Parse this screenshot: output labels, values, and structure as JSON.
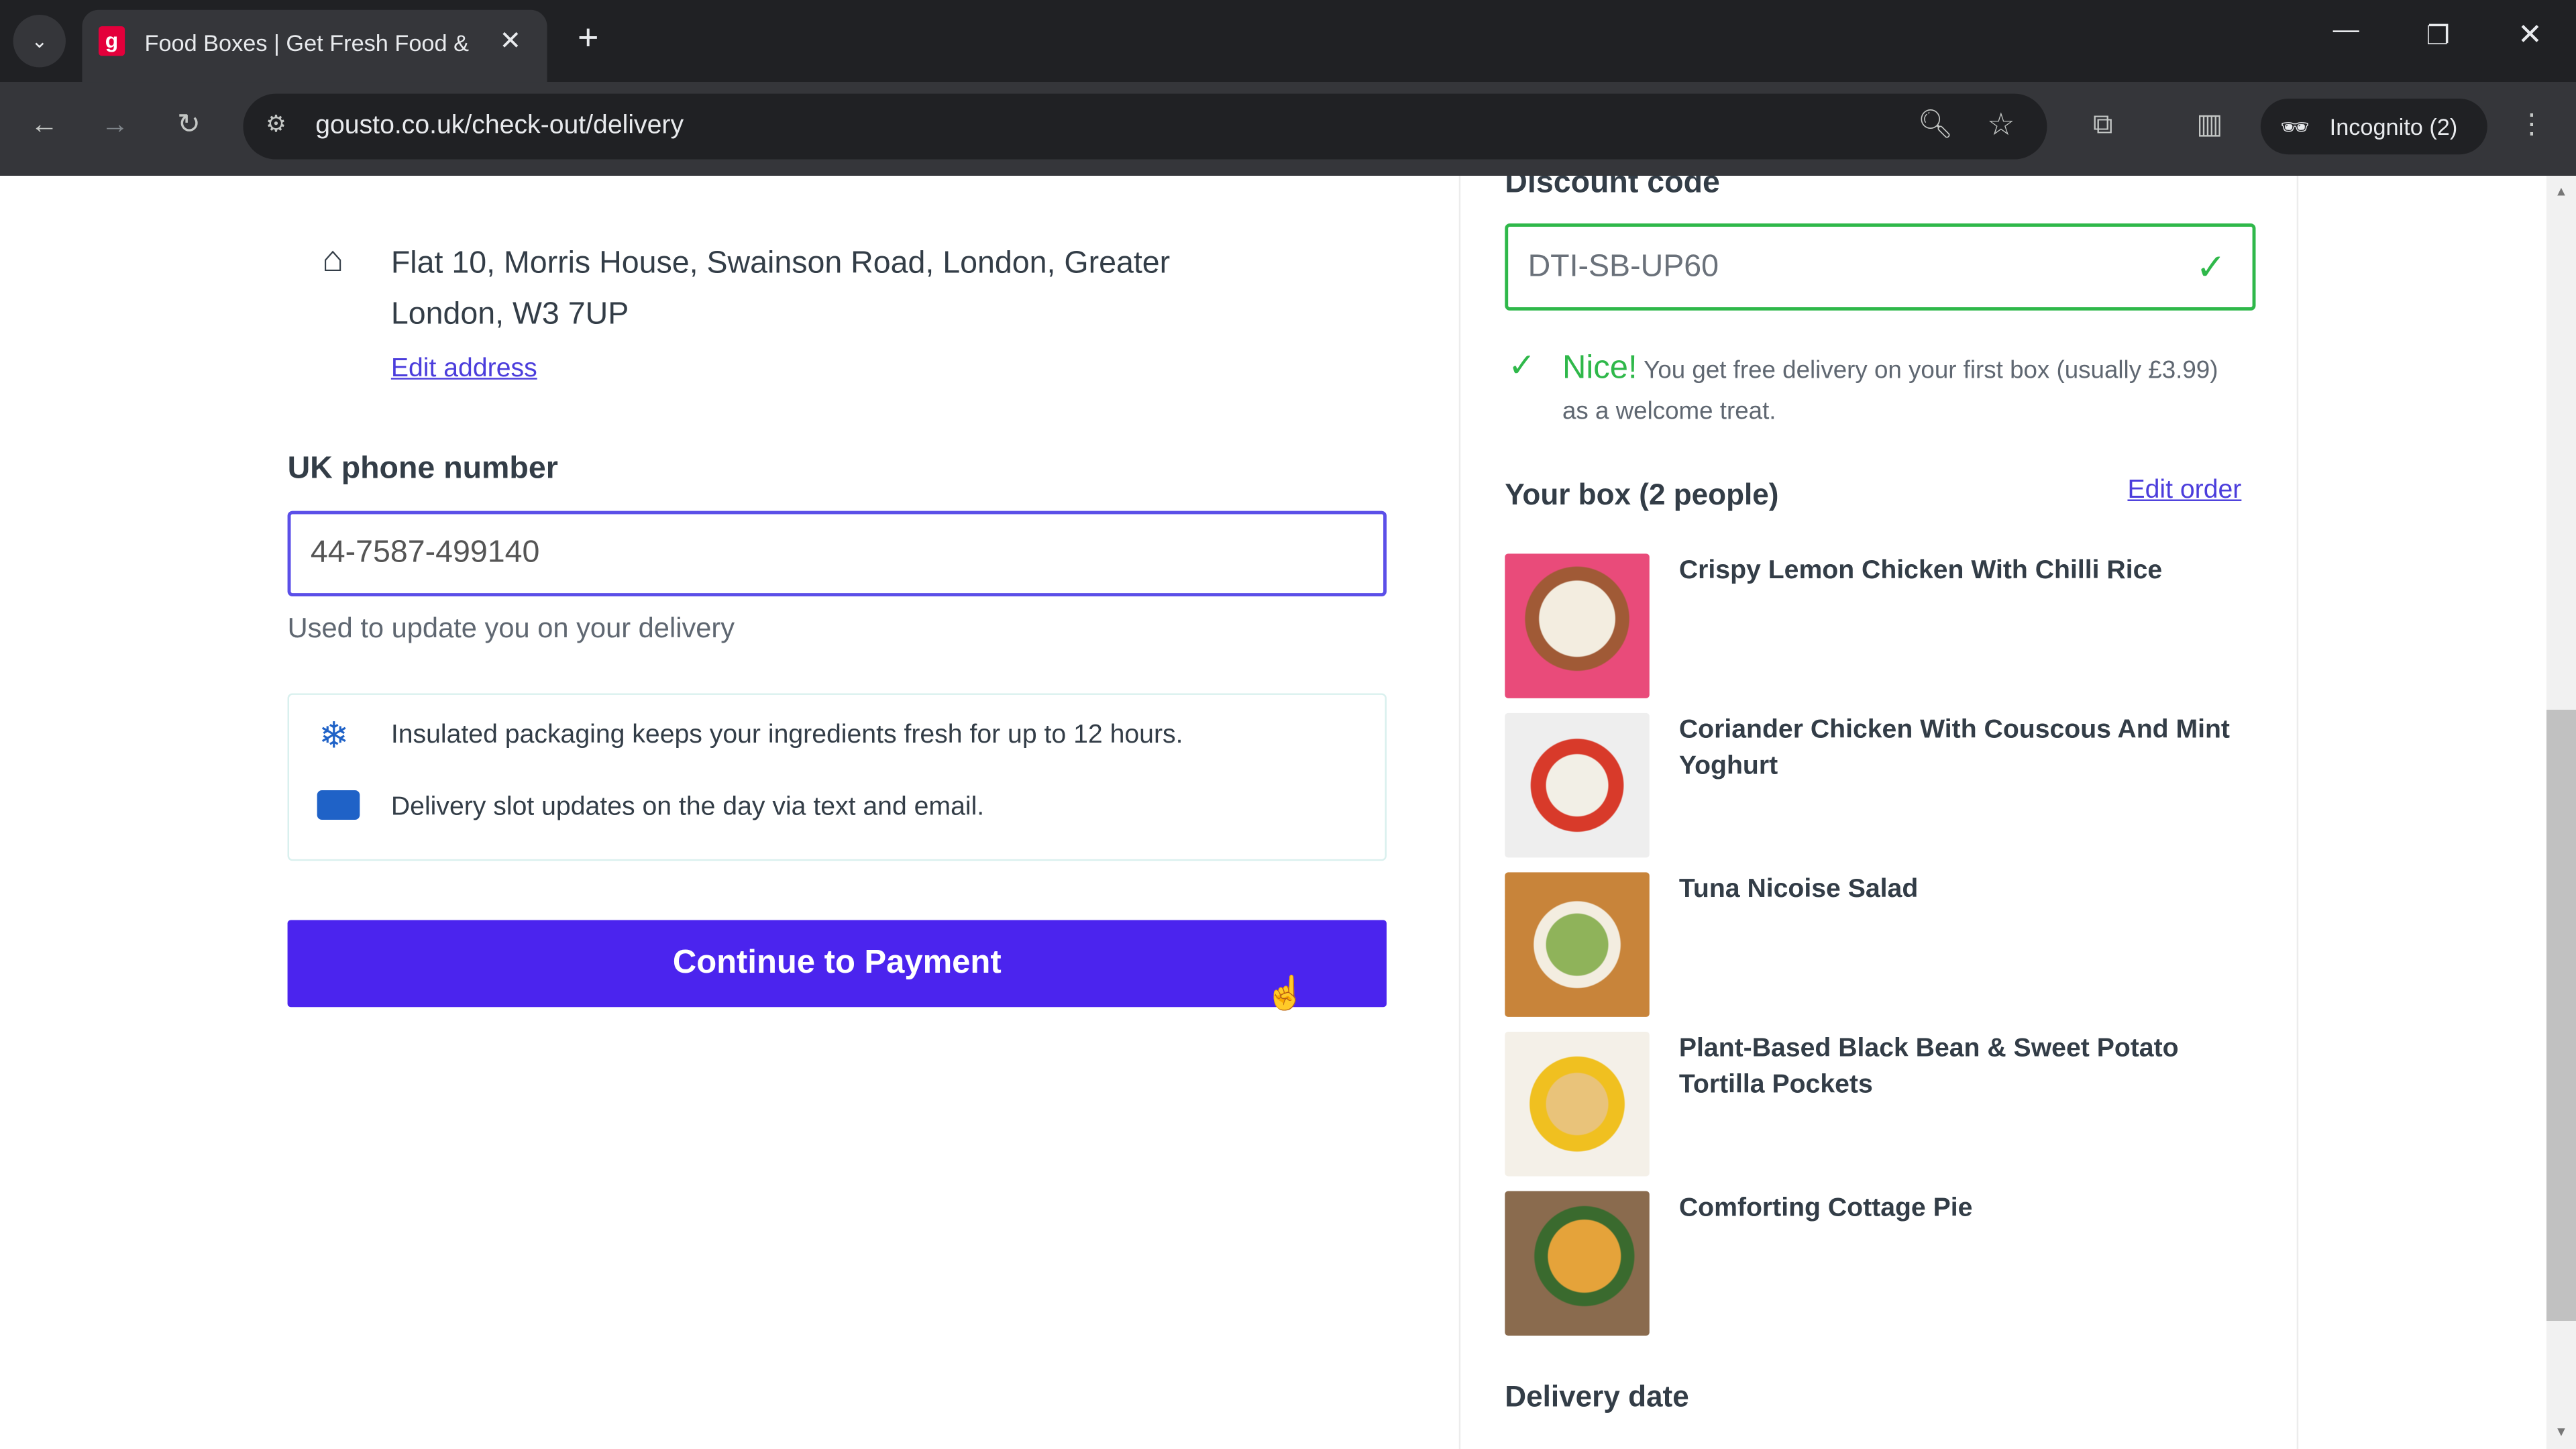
{
  "browser": {
    "tab_title": "Food Boxes | Get Fresh Food &",
    "url": "gousto.co.uk/check-out/delivery",
    "profile_label": "Incognito (2)"
  },
  "delivery": {
    "address_line1": "Flat 10, Morris House, Swainson Road, London, Greater",
    "address_line2": "London, W3 7UP",
    "edit_address": "Edit address",
    "phone_label": "UK phone number",
    "phone_value": "44-7587-499140",
    "phone_hint": "Used to update you on your delivery",
    "info": [
      {
        "icon": "snowflake-icon",
        "text": "Insulated packaging keeps your ingredients fresh for up to 12 hours."
      },
      {
        "icon": "truck-icon",
        "text": "Delivery slot updates on the day via text and email."
      }
    ],
    "continue_button": "Continue to Payment"
  },
  "summary": {
    "discount_label": "Discount code",
    "discount_value": "DTI-SB-UP60",
    "success_title": "Nice!",
    "success_text": "You get free delivery on your first box (usually £3.99) as a welcome treat.",
    "box_title": "Your box (2 people)",
    "edit_order": "Edit order",
    "meals": [
      {
        "name": "Crispy Lemon Chicken With Chilli Rice"
      },
      {
        "name": "Coriander Chicken With Couscous And Mint Yoghurt"
      },
      {
        "name": "Tuna Nicoise Salad"
      },
      {
        "name": "Plant-Based Black Bean & Sweet Potato Tortilla Pockets"
      },
      {
        "name": "Comforting Cottage Pie"
      }
    ],
    "delivery_date_label": "Delivery date"
  },
  "colors": {
    "accent": "#4b24ee",
    "success": "#2fb84a",
    "link": "#4b3ddc",
    "favicon": "#e4003b"
  }
}
